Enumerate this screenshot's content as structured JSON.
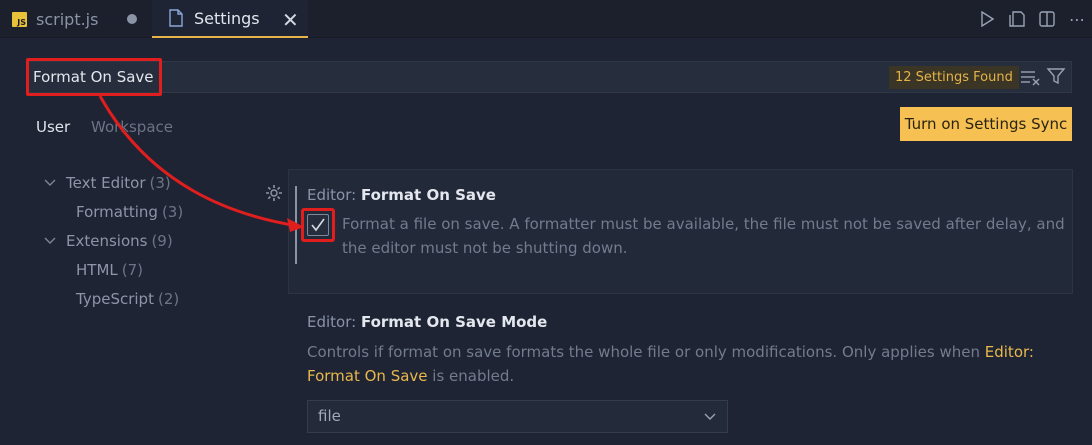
{
  "tabs": [
    {
      "label": "script.js",
      "badge": "JS"
    },
    {
      "label": "Settings"
    }
  ],
  "search": {
    "value": "Format On Save",
    "results_badge": "12 Settings Found"
  },
  "scope": {
    "user": "User",
    "workspace": "Workspace"
  },
  "sync_button": "Turn on Settings Sync",
  "toc": [
    {
      "label": "Text Editor",
      "count": "(3)"
    },
    {
      "label": "Formatting",
      "count": "(3)"
    },
    {
      "label": "Extensions",
      "count": "(9)"
    },
    {
      "label": "HTML",
      "count": "(7)"
    },
    {
      "label": "TypeScript",
      "count": "(2)"
    }
  ],
  "setting1": {
    "category": "Editor: ",
    "name": "Format On Save",
    "checked": true,
    "description_line1": "Format a file on save. A formatter must be available, the file must not be saved after delay, and",
    "description_line2": "the editor must not be shutting down."
  },
  "setting2": {
    "category": "Editor: ",
    "name": "Format On Save Mode",
    "description_line1": "Controls if format on save formats the whole file or only modifications. Only applies when ",
    "link_part1": "Editor:",
    "link_part2": "Format On Save",
    "description_line2_suffix": " is enabled.",
    "select_value": "file"
  },
  "colors": {
    "accent": "#e6b34a",
    "highlight_box": "#e01e1e",
    "sync_button_bg": "#f6c152"
  }
}
